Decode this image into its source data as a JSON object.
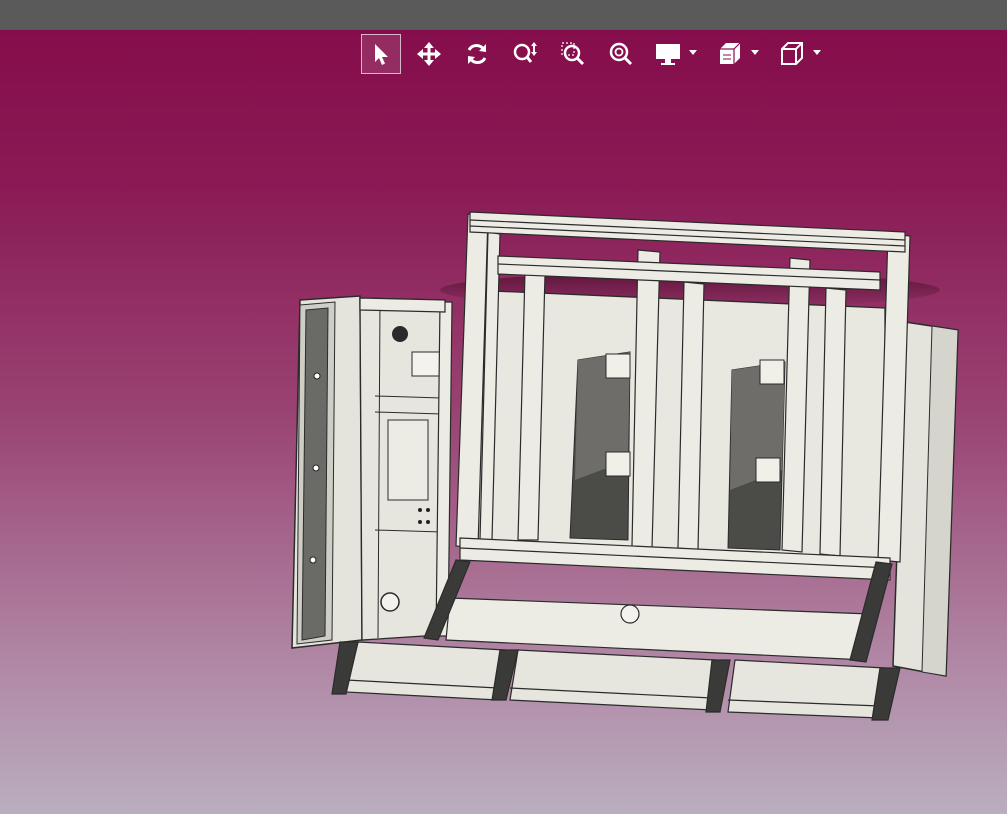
{
  "app": {
    "colors": {
      "topbar": "#5a5a5a",
      "background_top": "#850d4b",
      "background_bottom": "#baaec0",
      "icon": "#ffffff",
      "part_fill": "#e3e2da",
      "part_stroke": "#2b2b2b"
    }
  },
  "toolbar": {
    "buttons": [
      {
        "name": "select",
        "icon": "arrow-cursor-icon",
        "active": true
      },
      {
        "name": "pan",
        "icon": "move-arrows-icon"
      },
      {
        "name": "rotate",
        "icon": "rotate-icon"
      },
      {
        "name": "zoom",
        "icon": "zoom-updown-icon"
      },
      {
        "name": "zoom-window",
        "icon": "zoom-window-icon"
      },
      {
        "name": "zoom-fit",
        "icon": "zoom-fit-icon"
      },
      {
        "name": "display-mode",
        "icon": "monitor-icon",
        "dropdown": true
      },
      {
        "name": "section-view",
        "icon": "section-cube-icon",
        "dropdown": true
      },
      {
        "name": "view-orientation",
        "icon": "cube-icon",
        "dropdown": true
      }
    ]
  },
  "model": {
    "description_icon": "3d-frame-assembly"
  }
}
